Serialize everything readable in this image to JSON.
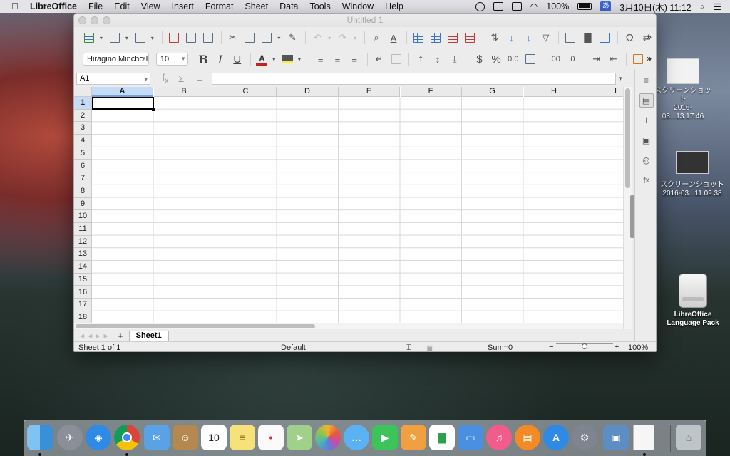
{
  "menubar": {
    "app_name": "LibreOffice",
    "items": [
      "File",
      "Edit",
      "View",
      "Insert",
      "Format",
      "Sheet",
      "Data",
      "Tools",
      "Window",
      "Help"
    ],
    "battery": "100%",
    "ime": "あ",
    "datetime": "3月10日(木)  11:12"
  },
  "window": {
    "title": "Untitled 1",
    "font_name": "Hiragino Mincho I",
    "font_size": "10",
    "cell_ref": "A1"
  },
  "sheet": {
    "columns": [
      "A",
      "B",
      "C",
      "D",
      "E",
      "F",
      "G",
      "H",
      "I"
    ],
    "rows": [
      "1",
      "2",
      "3",
      "4",
      "5",
      "6",
      "7",
      "8",
      "9",
      "10",
      "11",
      "12",
      "13",
      "14",
      "15",
      "16",
      "17",
      "18"
    ],
    "selected_column": "A",
    "selected_row": "1",
    "tab_name": "Sheet1"
  },
  "status": {
    "sheet_info": "Sheet 1 of 1",
    "page_style": "Default",
    "sum": "Sum=0",
    "zoom": "100%",
    "zoom_minus": "−",
    "zoom_plus": "+"
  },
  "desktop": {
    "icon1_line1": "スクリーンショット",
    "icon1_line2": "2016-03...13.17.46",
    "icon2_line1": "スクリーンショット",
    "icon2_line2": "2016-03...11.09.38",
    "icon3_line1": "LibreOffice",
    "icon3_line2": "Language Pack"
  },
  "dock_icons": [
    "finder",
    "launchpad",
    "safari",
    "chrome",
    "mail",
    "contacts",
    "calendar",
    "notes",
    "reminders",
    "maps",
    "photos",
    "messages",
    "facetime",
    "pages",
    "numbers",
    "keynote",
    "itunes",
    "ibooks",
    "app-store",
    "system-preferences",
    "preview",
    "document",
    "trash"
  ],
  "dock_calendar_day": "10",
  "colors": {
    "selection": "#c6dbf5",
    "font_color": "#c9211e",
    "highlight": "#ffeb3b"
  }
}
